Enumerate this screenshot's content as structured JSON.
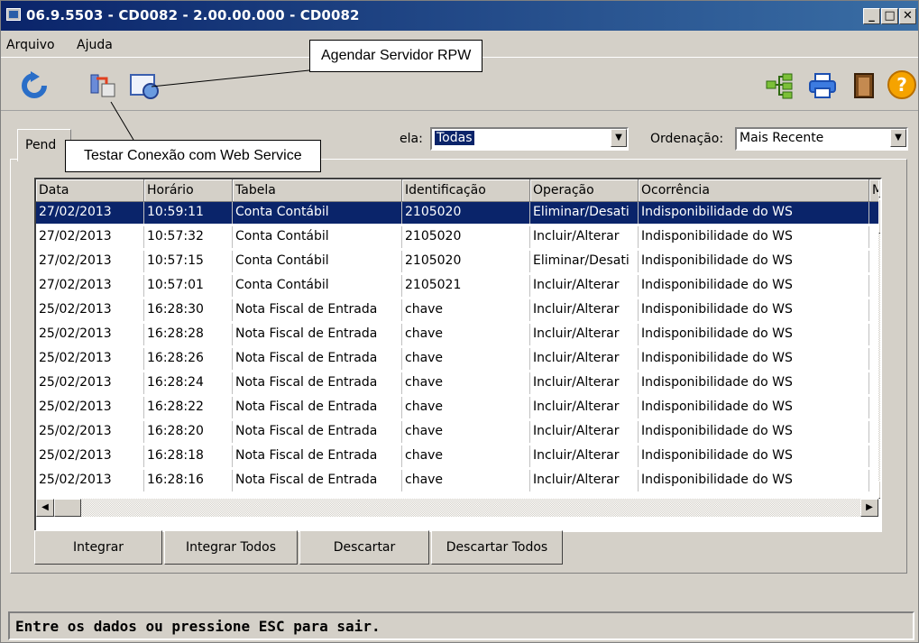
{
  "window": {
    "title": "06.9.5503 - CD0082 - 2.00.00.000 - CD0082"
  },
  "menu": {
    "items": [
      "Arquivo",
      "Ajuda"
    ]
  },
  "tab": {
    "label": "Pend"
  },
  "filters": {
    "tabela_label": "ela:",
    "tabela_value": "Todas",
    "ordenacao_label": "Ordenação:",
    "ordenacao_value": "Mais Recente"
  },
  "grid": {
    "columns": [
      "Data",
      "Horário",
      "Tabela",
      "Identificação",
      "Operação",
      "Ocorrência",
      "M"
    ],
    "rows": [
      [
        "27/02/2013",
        "10:59:11",
        "Conta Contábil",
        "2105020",
        "Eliminar/Desati",
        "Indisponibilidade do WS"
      ],
      [
        "27/02/2013",
        "10:57:32",
        "Conta Contábil",
        "2105020",
        "Incluir/Alterar",
        "Indisponibilidade do WS"
      ],
      [
        "27/02/2013",
        "10:57:15",
        "Conta Contábil",
        "2105020",
        "Eliminar/Desati",
        "Indisponibilidade do WS"
      ],
      [
        "27/02/2013",
        "10:57:01",
        "Conta Contábil",
        "2105021",
        "Incluir/Alterar",
        "Indisponibilidade do WS"
      ],
      [
        "25/02/2013",
        "16:28:30",
        "Nota Fiscal de Entrada",
        "chave",
        "Incluir/Alterar",
        "Indisponibilidade do WS"
      ],
      [
        "25/02/2013",
        "16:28:28",
        "Nota Fiscal de Entrada",
        "chave",
        "Incluir/Alterar",
        "Indisponibilidade do WS"
      ],
      [
        "25/02/2013",
        "16:28:26",
        "Nota Fiscal de Entrada",
        "chave",
        "Incluir/Alterar",
        "Indisponibilidade do WS"
      ],
      [
        "25/02/2013",
        "16:28:24",
        "Nota Fiscal de Entrada",
        "chave",
        "Incluir/Alterar",
        "Indisponibilidade do WS"
      ],
      [
        "25/02/2013",
        "16:28:22",
        "Nota Fiscal de Entrada",
        "chave",
        "Incluir/Alterar",
        "Indisponibilidade do WS"
      ],
      [
        "25/02/2013",
        "16:28:20",
        "Nota Fiscal de Entrada",
        "chave",
        "Incluir/Alterar",
        "Indisponibilidade do WS"
      ],
      [
        "25/02/2013",
        "16:28:18",
        "Nota Fiscal de Entrada",
        "chave",
        "Incluir/Alterar",
        "Indisponibilidade do WS"
      ],
      [
        "25/02/2013",
        "16:28:16",
        "Nota Fiscal de Entrada",
        "chave",
        "Incluir/Alterar",
        "Indisponibilidade do WS"
      ]
    ]
  },
  "buttons": {
    "integrar": "Integrar",
    "integrar_todos": "Integrar Todos",
    "descartar": "Descartar",
    "descartar_todos": "Descartar Todos"
  },
  "status": {
    "text": "Entre os dados ou pressione ESC para sair."
  },
  "callouts": {
    "agendar": "Agendar Servidor RPW",
    "testar": "Testar Conexão com Web Service"
  },
  "icons": {
    "refresh": "refresh-icon",
    "test_connection": "test-connection-icon",
    "schedule": "schedule-rpw-icon",
    "tree": "tree-icon",
    "print": "printer-icon",
    "exit": "exit-door-icon",
    "help": "help-icon"
  },
  "colors": {
    "titlebar": "#0a246a",
    "selection": "#0a246a",
    "face": "#d4d0c8"
  }
}
